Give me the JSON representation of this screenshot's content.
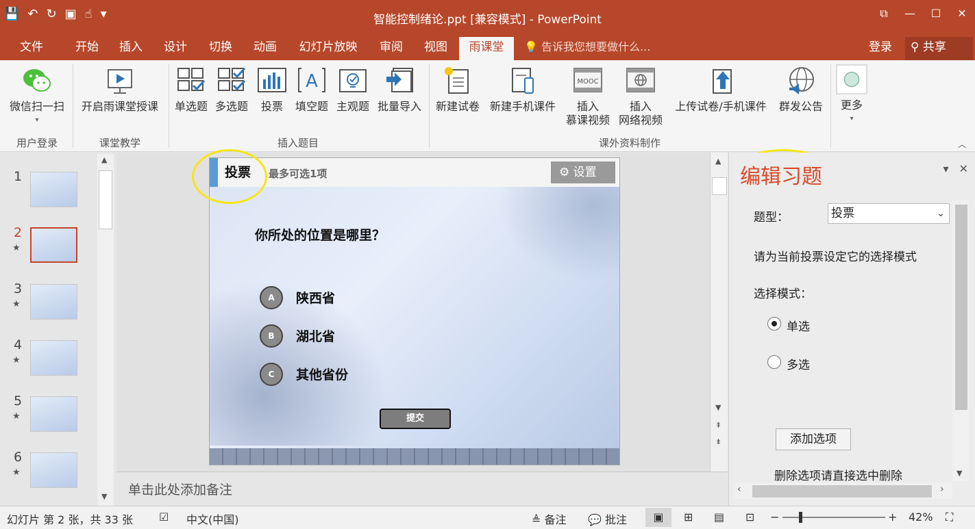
{
  "window": {
    "title": "智能控制绪论.ppt [兼容模式] - PowerPoint",
    "controls": [
      "⧉",
      "—",
      "☐",
      "✕"
    ]
  },
  "tabs": [
    {
      "label": "文件"
    },
    {
      "label": "开始"
    },
    {
      "label": "插入"
    },
    {
      "label": "设计"
    },
    {
      "label": "切换"
    },
    {
      "label": "动画"
    },
    {
      "label": "幻灯片放映"
    },
    {
      "label": "审阅"
    },
    {
      "label": "视图"
    },
    {
      "label": "雨课堂"
    }
  ],
  "active_tab": "雨课堂",
  "tell_me": "告诉我您想要做什么...",
  "login": "登录",
  "share": "共享",
  "ribbon": {
    "wechat_scan": "微信扫一扫",
    "group_user_login": "用户登录",
    "start_class": "开启雨课堂授课",
    "group_class_teaching": "课堂教学",
    "single_choice": "单选题",
    "multi_choice": "多选题",
    "vote": "投票",
    "fill_blank": "填空题",
    "subjective": "主观题",
    "batch_import": "批量导入",
    "group_insert_question": "插入题目",
    "new_paper": "新建试卷",
    "new_mobile": "新建手机课件",
    "insert_mooc_1": "插入",
    "insert_mooc_2": "慕课视频",
    "mooc_tag": "MOOC",
    "insert_web_1": "插入",
    "insert_web_2": "网络视频",
    "upload": "上传试卷/手机课件",
    "notice": "群发公告",
    "group_extra": "课外资料制作",
    "more": "更多"
  },
  "thumbnails": [
    {
      "num": "1",
      "star": ""
    },
    {
      "num": "2",
      "star": "★"
    },
    {
      "num": "3",
      "star": "★"
    },
    {
      "num": "4",
      "star": "★"
    },
    {
      "num": "5",
      "star": "★"
    },
    {
      "num": "6",
      "star": "★"
    }
  ],
  "selected_slide": "2",
  "slide": {
    "kind": "投票",
    "hint": "最多可选1项",
    "settings": "设置",
    "question": "你所处的位置是哪里？",
    "options": [
      {
        "letter": "A",
        "text": "陕西省"
      },
      {
        "letter": "B",
        "text": "湖北省"
      },
      {
        "letter": "C",
        "text": "其他省份"
      }
    ],
    "submit": "提交"
  },
  "notes_placeholder": "单击此处添加备注",
  "pane": {
    "title": "编辑习题",
    "type_label": "题型：",
    "type_value": "投票",
    "instruction": "请为当前投票设定它的选择模式",
    "mode_label": "选择模式：",
    "mode_single": "单选",
    "mode_multi": "多选",
    "add_option": "添加选项",
    "delete_hint": "删除选项请直接选中删除"
  },
  "status": {
    "slide_info": "幻灯片 第 2 张，共 33 张",
    "language": "中文(中国)",
    "notes": "备注",
    "comments": "批注",
    "zoom": "42%"
  },
  "colors": {
    "accent": "#b7472a",
    "highlight_ellipse": "#f5e616",
    "pane_title": "#d84a2a",
    "slide_bar": "#5b9bd5"
  }
}
